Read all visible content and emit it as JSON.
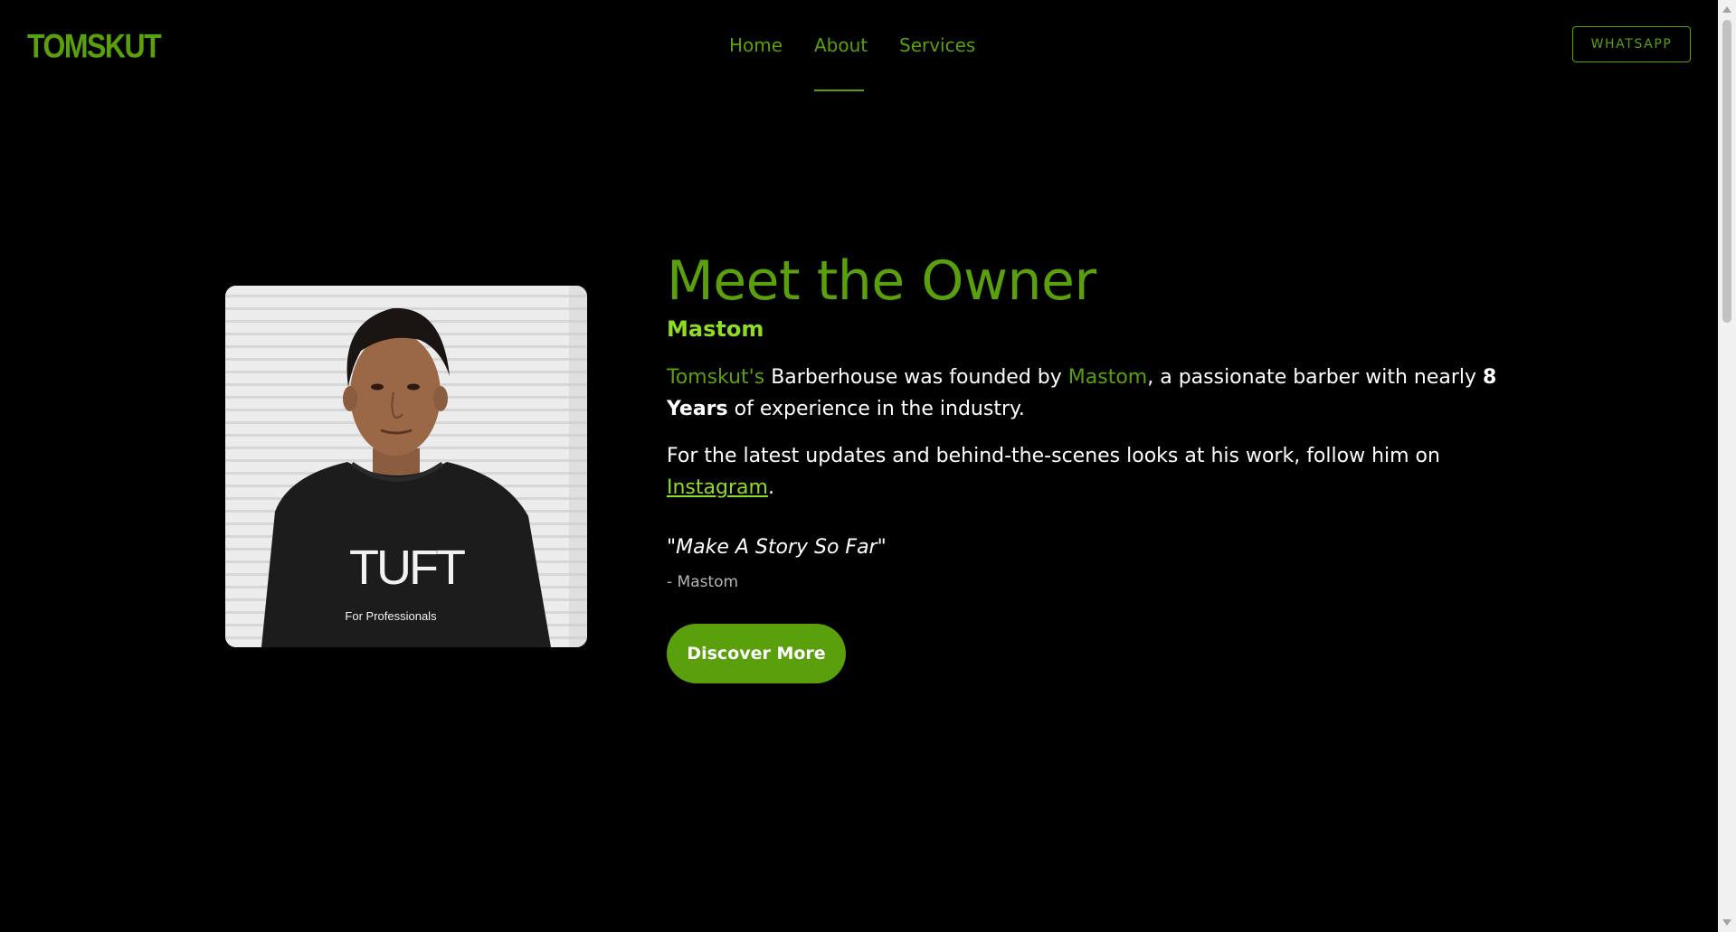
{
  "header": {
    "logo": "TOMSKUT",
    "nav": {
      "home": "Home",
      "about": "About",
      "services": "Services"
    },
    "whatsapp": "WHATSAPP"
  },
  "about": {
    "heading": "Meet the Owner",
    "owner_name": "Mastom",
    "para1": {
      "brand": "Tomskut's",
      "text1": " Barberhouse was founded by ",
      "owner": "Mastom",
      "text2": ", a passionate barber with nearly ",
      "years": "8 Years",
      "text3": " of experience in the industry."
    },
    "para2": {
      "text": "For the latest updates and behind-the-scenes looks at his work, follow him on ",
      "link": "Instagram",
      "end": "."
    },
    "quote": "\"Make A Story So Far\"",
    "quote_author": "- Mastom",
    "button": "Discover More"
  },
  "photo": {
    "shirt_brand": "TUFT",
    "shirt_tagline": "For Professionals"
  },
  "colors": {
    "accent": "#5aa00d",
    "accent_light": "#8fdc24",
    "background": "#000000"
  }
}
